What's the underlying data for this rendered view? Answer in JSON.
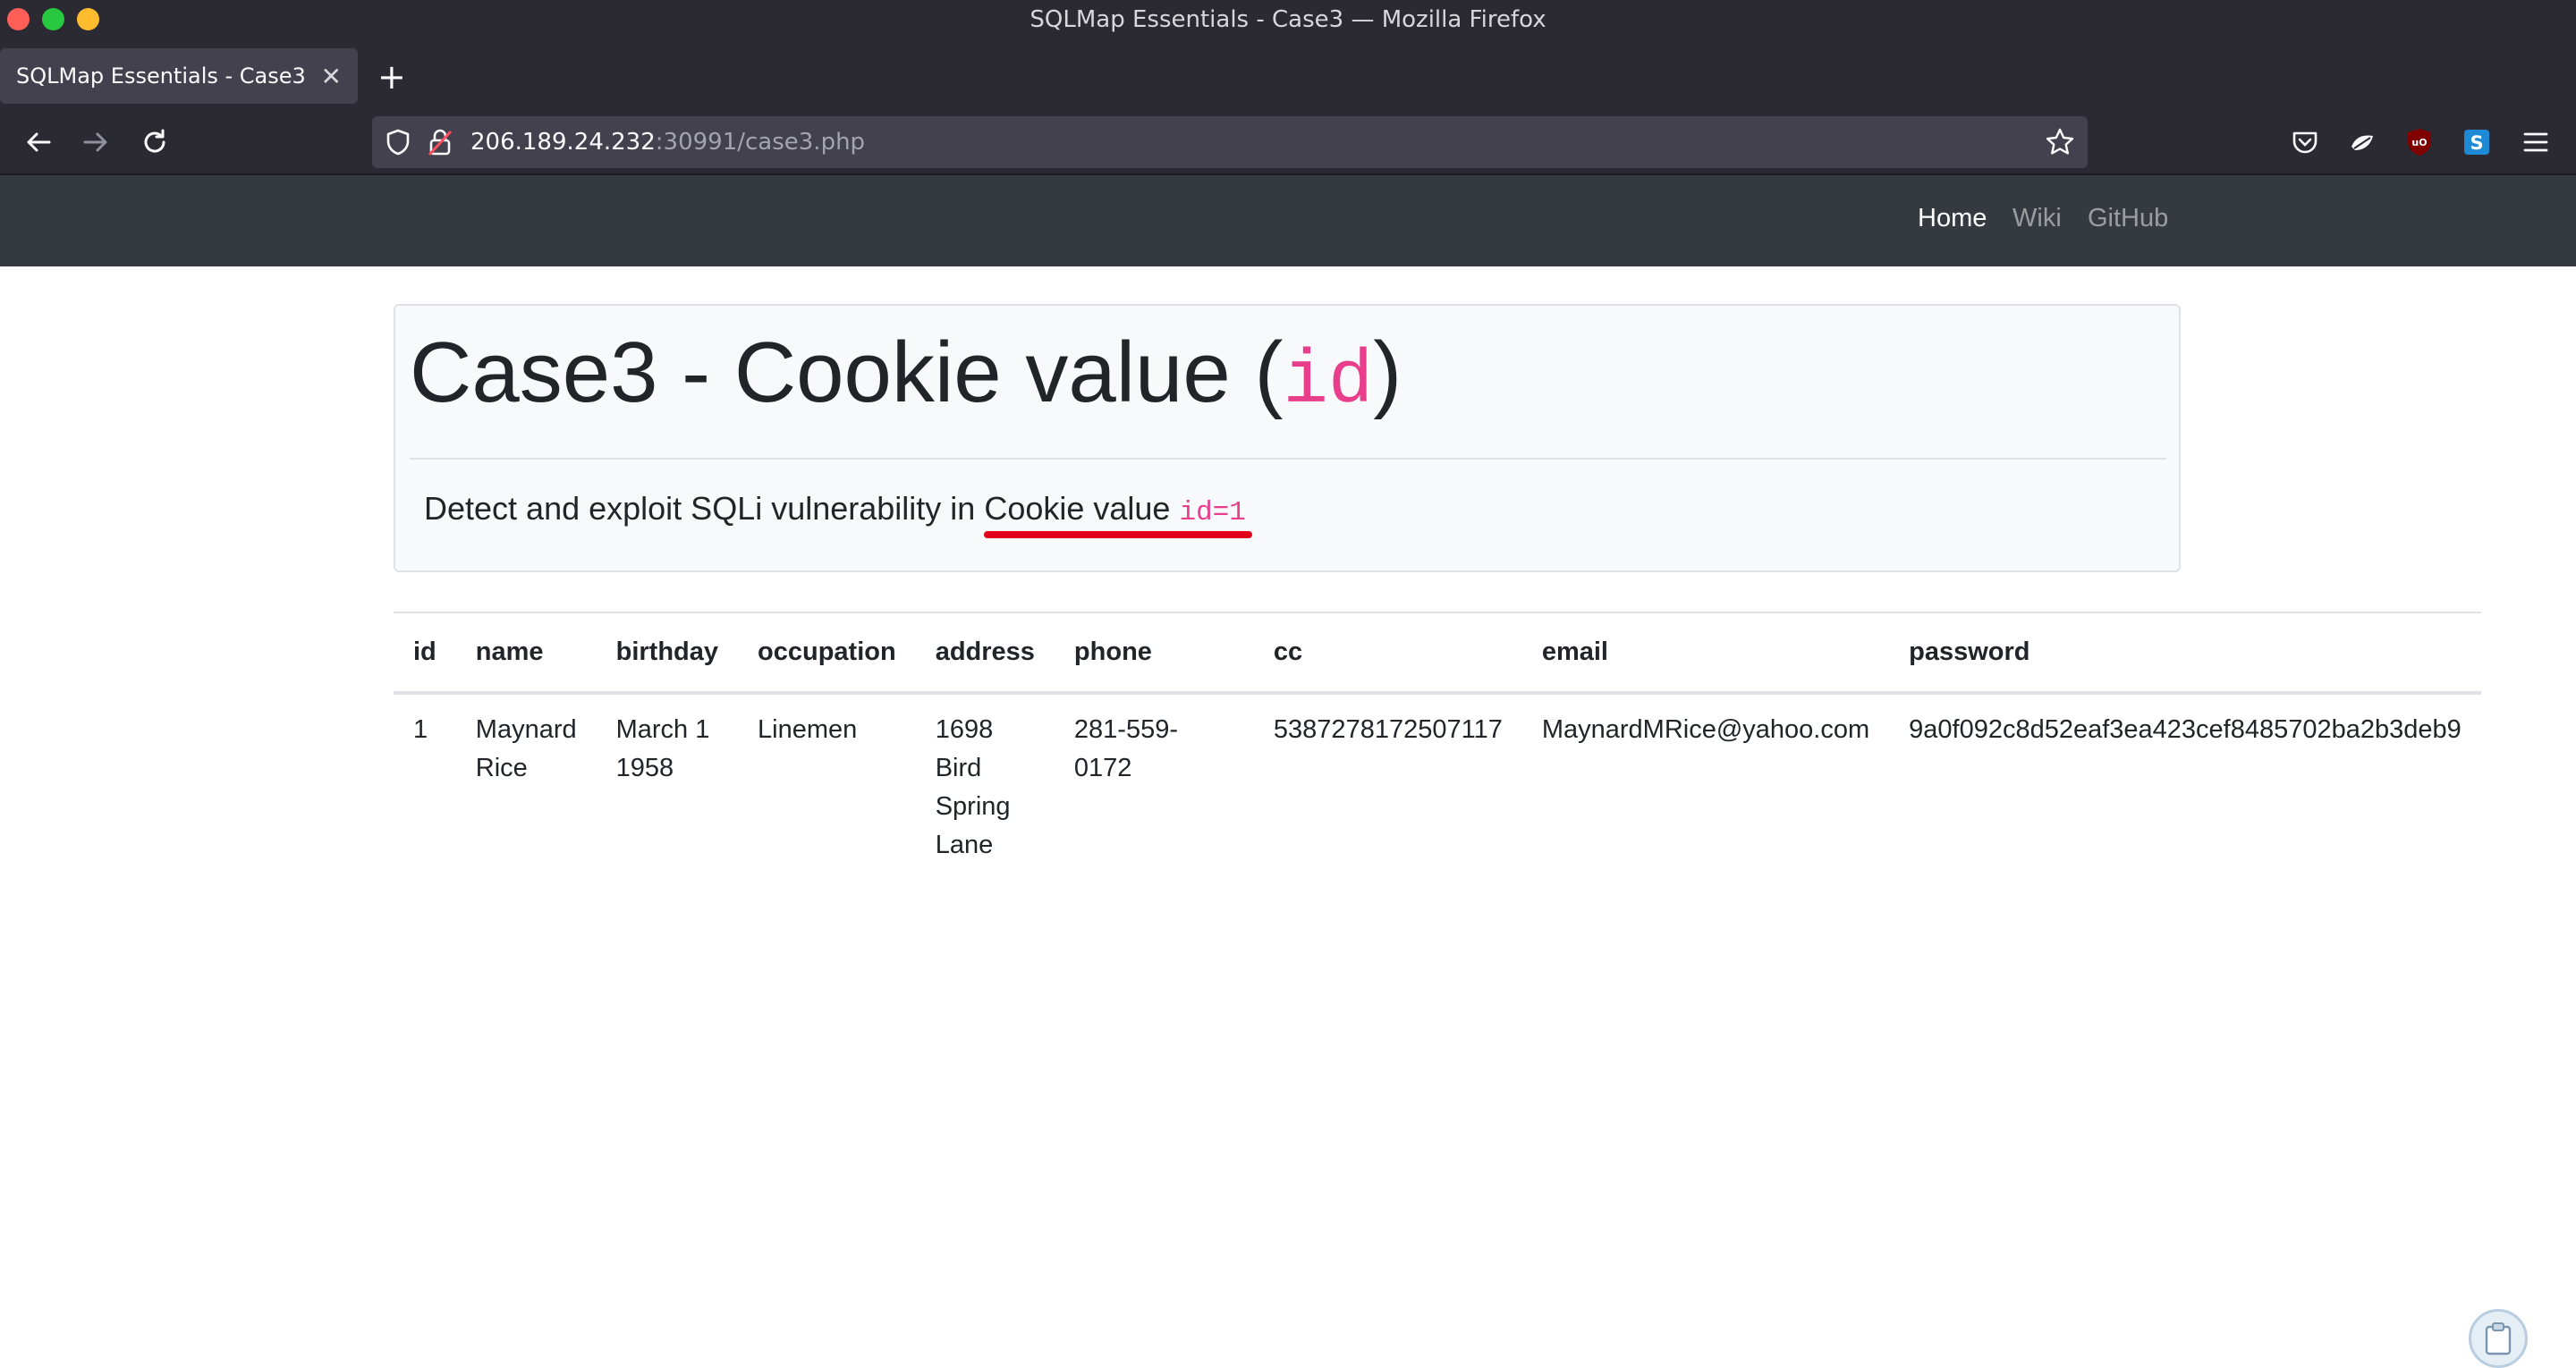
{
  "window": {
    "title": "SQLMap Essentials - Case3 — Mozilla Firefox"
  },
  "tabs": [
    {
      "label": "SQLMap Essentials - Case3",
      "active": true
    }
  ],
  "urlbar": {
    "host": "206.189.24.232",
    "path": ":30991/case3.php"
  },
  "toolbar_icons": [
    "pocket-icon",
    "extension-icon",
    "ublock-icon",
    "s-extension-icon",
    "menu-icon"
  ],
  "site_nav": {
    "items": [
      {
        "label": "Home",
        "active": true
      },
      {
        "label": "Wiki",
        "active": false
      },
      {
        "label": "GitHub",
        "active": false
      }
    ]
  },
  "jumbotron": {
    "title_prefix": "Case3 - Cookie value (",
    "title_code": "id",
    "title_suffix": ")",
    "lead_text": "Detect and exploit SQLi vulnerability in ",
    "lead_highlight": "Cookie value ",
    "lead_code": "id=1"
  },
  "table": {
    "columns": [
      "id",
      "name",
      "birthday",
      "occupation",
      "address",
      "phone",
      "cc",
      "email",
      "password"
    ],
    "rows": [
      {
        "id": "1",
        "name": [
          "Maynard",
          "Rice"
        ],
        "birthday": [
          "March 1",
          "1958"
        ],
        "occupation": "Linemen",
        "address": [
          "1698",
          "Bird",
          "Spring",
          "Lane"
        ],
        "phone": "281-559-0172",
        "cc": "5387278172507117",
        "email": "MaynardMRice@yahoo.com",
        "password": "9a0f092c8d52eaf3ea423cef8485702ba2b3deb9"
      }
    ]
  },
  "colors": {
    "chrome_bg": "#2b2a33",
    "urlbar_bg": "#42414d",
    "site_nav_bg": "#343a40",
    "code_pink": "#e83e8c",
    "annotation_red": "#e0001a"
  }
}
